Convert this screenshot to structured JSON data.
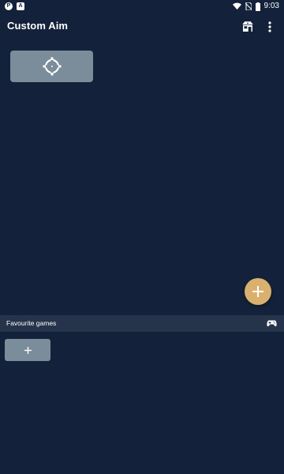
{
  "status_bar": {
    "notifications": [
      "P",
      "A"
    ],
    "time": "9:03"
  },
  "app_bar": {
    "title": "Custom Aim",
    "actions": [
      "store-icon",
      "more-vert-icon"
    ]
  },
  "crosshair_card": {
    "icon": "crosshair-icon"
  },
  "fab": {
    "icon": "plus-icon"
  },
  "favourites": {
    "title": "Favourite games",
    "icon": "gamepad-icon",
    "add_icon": "plus-icon"
  },
  "colors": {
    "background": "#13213a",
    "section_bar": "#26344b",
    "card": "#7b8c9a",
    "accent": "#d9b06e",
    "text": "#ffffff"
  }
}
